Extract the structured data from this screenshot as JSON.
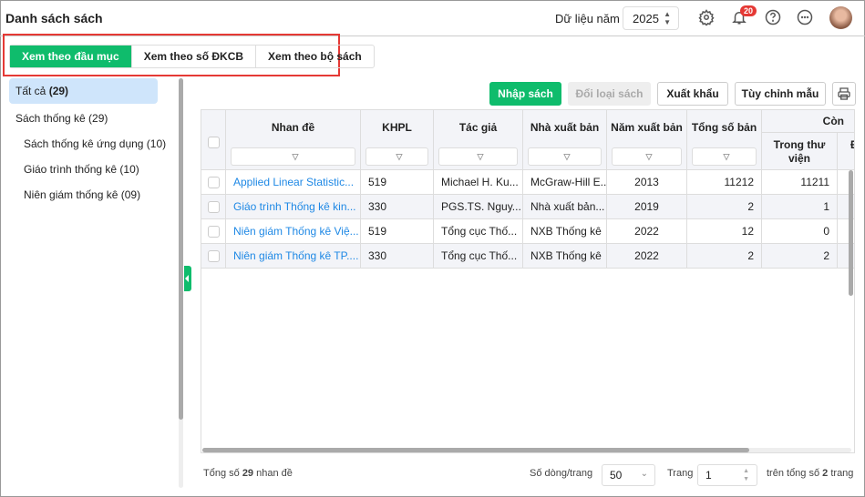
{
  "header": {
    "title": "Danh sách sách",
    "year_label": "Dữ liệu năm",
    "year": "2025",
    "notification_count": "20"
  },
  "tabs": [
    {
      "label": "Xem theo đầu mục",
      "active": true
    },
    {
      "label": "Xem theo số ĐKCB"
    },
    {
      "label": "Xem theo bộ sách"
    }
  ],
  "sidebar": {
    "items": [
      {
        "label": "Tất cả",
        "count": "(29)"
      },
      {
        "label": "Sách thống kê (29)"
      },
      {
        "label": "Sách thống kê ứng dụng (10)"
      },
      {
        "label": "Giáo trình thống kê (10)"
      },
      {
        "label": "Niên giám thống kê (09)"
      }
    ]
  },
  "toolbar": {
    "import": "Nhập sách",
    "change_type": "Đổi loại sách",
    "export": "Xuất khẩu",
    "customize": "Tùy chỉnh mẫu"
  },
  "table": {
    "columns": {
      "title": "Nhan đề",
      "khpl": "KHPL",
      "author": "Tác giả",
      "publisher": "Nhà xuất bản",
      "year": "Năm xuất bản",
      "total": "Tổng số bản",
      "remaining": "Còn",
      "in_library": "Trong thư viện",
      "next": "Đ"
    },
    "rows": [
      {
        "title": "Applied Linear Statistic...",
        "khpl": "519",
        "author": "Michael H. Ku...",
        "publisher": "McGraw-Hill E...",
        "year": "2013",
        "total": "11212",
        "in_library": "11211"
      },
      {
        "title": "Giáo trình Thống kê kin...",
        "khpl": "330",
        "author": "PGS.TS. Nguy...",
        "publisher": "Nhà xuất bản...",
        "year": "2019",
        "total": "2",
        "in_library": "1"
      },
      {
        "title": "Niên giám Thống kê Việ...",
        "khpl": "519",
        "author": "Tổng cục Thố...",
        "publisher": "NXB Thống kê",
        "year": "2022",
        "total": "12",
        "in_library": "0"
      },
      {
        "title": "Niên giám Thống kê TP....",
        "khpl": "330",
        "author": "Tổng cục Thố...",
        "publisher": "NXB Thống kê",
        "year": "2022",
        "total": "2",
        "in_library": "2"
      }
    ]
  },
  "footer": {
    "total_prefix": "Tổng số",
    "total": "29",
    "total_suffix": "nhan đề",
    "rows_label": "Số dòng/trang",
    "rows_per_page": "50",
    "page_label": "Trang",
    "page": "1",
    "of_prefix": "trên tổng số",
    "pages": "2",
    "of_suffix": "trang"
  }
}
